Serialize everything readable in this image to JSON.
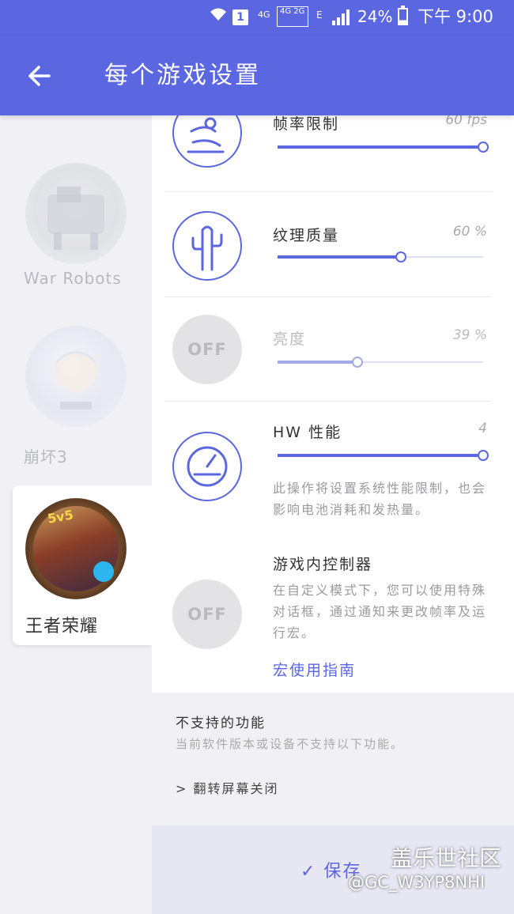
{
  "status_bar": {
    "sim_slot": "1",
    "net_4g": "4G",
    "net_4g_2g": "4G 2G",
    "net_e": "E",
    "battery_percent": "24%",
    "time": "下午 9:00"
  },
  "toolbar": {
    "title": "每个游戏设置"
  },
  "games": [
    {
      "name": "War Robots"
    },
    {
      "name": "崩坏3"
    },
    {
      "name": "王者荣耀",
      "badge": "5v5"
    }
  ],
  "settings": {
    "frame_rate": {
      "label": "帧率限制",
      "value": "60 fps",
      "level": 1.0
    },
    "texture": {
      "label": "纹理质量",
      "value": "60 %",
      "level": 0.6
    },
    "brightness": {
      "label": "亮度",
      "value": "39 %",
      "level": 0.39,
      "off_label": "OFF"
    },
    "hw": {
      "label": "HW 性能",
      "value": "4",
      "level": 1.0,
      "desc": "此操作将设置系统性能限制，也会影响电池消耗和发热量。"
    },
    "controller": {
      "label": "游戏内控制器",
      "off_label": "OFF",
      "desc": "在自定义模式下，您可以使用特殊对话框，通过通知来更改帧率及运行宏。",
      "link": "宏使用指南"
    }
  },
  "unsupported": {
    "title": "不支持的功能",
    "subtitle": "当前软件版本或设备不支持以下功能。",
    "items": [
      "> 翻转屏幕关闭"
    ]
  },
  "save": {
    "label": "✓ 保存"
  },
  "watermark": {
    "line1": "盖乐世社区",
    "line2": "@GC_W3YP8NHI"
  },
  "colors": {
    "accent": "#5a67e0",
    "panel_gray": "#f1f1f5",
    "save_bar": "#e6e7f3"
  }
}
